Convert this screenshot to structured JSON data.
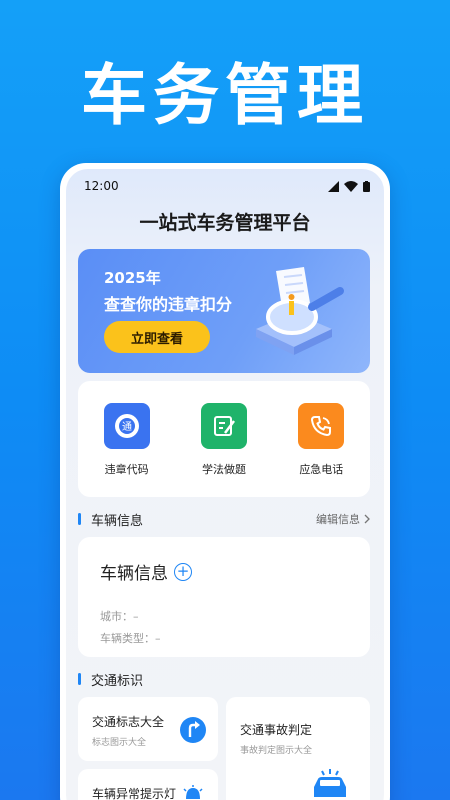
{
  "headline": "车务管理",
  "status_bar": {
    "time": "12:00"
  },
  "app_title": "一站式车务管理平台",
  "banner": {
    "year": "2025年",
    "text": "查查你的违章扣分",
    "button_label": "立即查看"
  },
  "quick_actions": [
    {
      "label": "违章代码",
      "icon": "road-sign-icon",
      "color": "#3a73f0"
    },
    {
      "label": "学法做题",
      "icon": "edit-note-icon",
      "color": "#1fb36a"
    },
    {
      "label": "应急电话",
      "icon": "phone-icon",
      "color": "#fb8a1e"
    }
  ],
  "vehicle_section": {
    "title": "车辆信息",
    "edit_link": "编辑信息",
    "card_title": "车辆信息",
    "city_label": "城市：",
    "city_value": "–",
    "type_label": "车辆类型：",
    "type_value": "–"
  },
  "traffic_section": {
    "title": "交通标识",
    "cards": [
      {
        "title": "交通标志大全",
        "subtitle": "标志图示大全"
      },
      {
        "title": "交通事故判定",
        "subtitle": "事故判定图示大全"
      },
      {
        "title": "车辆异常提示灯",
        "subtitle": ""
      }
    ]
  },
  "colors": {
    "accent": "#1f86f5",
    "button": "#fbc21b",
    "background": "#0e8cf5"
  }
}
